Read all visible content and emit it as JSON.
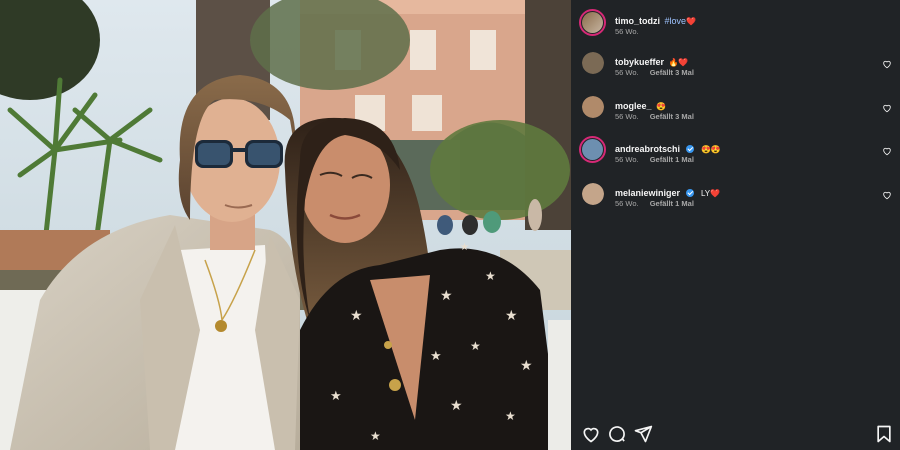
{
  "post": {
    "author": "timo_todzi",
    "caption_tag": "#love",
    "caption_emoji": "❤️",
    "age": "56 Wo."
  },
  "comments": [
    {
      "user": "tobykueffer",
      "verified": false,
      "text": "🔥❤️",
      "age": "56 Wo.",
      "likes": "Gefällt 3 Mal",
      "avatar_color": "#7b6a55"
    },
    {
      "user": "moglee_",
      "verified": false,
      "text": "😍",
      "age": "56 Wo.",
      "likes": "Gefällt 3 Mal",
      "avatar_color": "#b08a6a"
    },
    {
      "user": "andreabrotschi",
      "verified": true,
      "text": "😍😍",
      "age": "56 Wo.",
      "likes": "Gefällt 1 Mal",
      "avatar_color": "#6d8fb0"
    },
    {
      "user": "melaniewiniger",
      "verified": true,
      "text": "LY❤️",
      "age": "56 Wo.",
      "likes": "Gefällt 1 Mal",
      "avatar_color": "#c4a58a"
    }
  ],
  "colors": {
    "panel_bg": "#202326",
    "photo_bg": "#000000",
    "story_ring": "#d62976",
    "verified": "#3897f0",
    "hashtag": "#9ec3ff"
  },
  "icons": {
    "like": "heart-outline-icon",
    "comment": "comment-bubble-icon",
    "share": "paper-plane-icon",
    "save": "bookmark-icon"
  }
}
